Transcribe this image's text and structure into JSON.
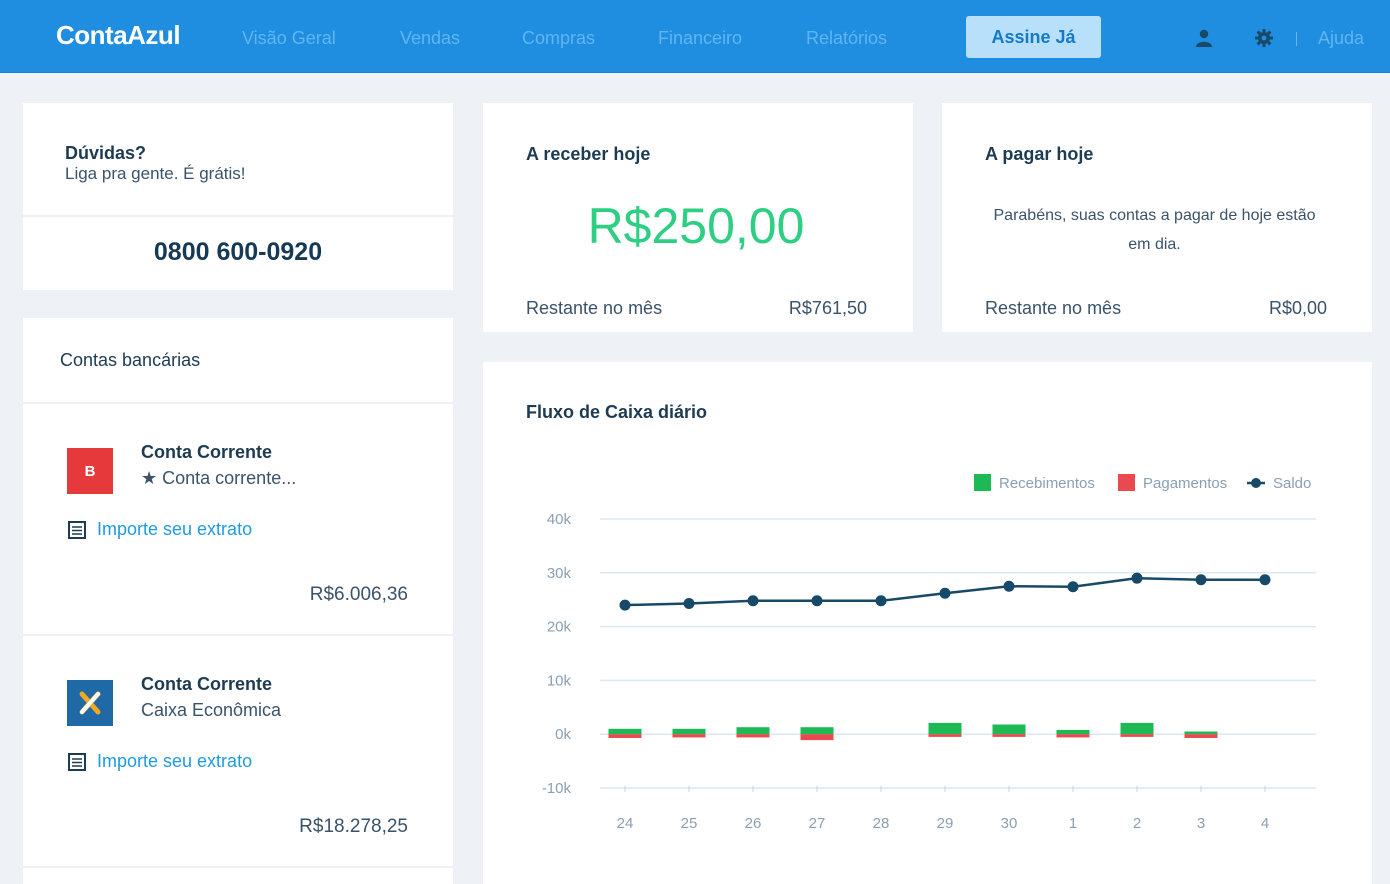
{
  "header": {
    "logo": "ContaAzul",
    "nav": [
      "Visão Geral",
      "Vendas",
      "Compras",
      "Financeiro",
      "Relatórios"
    ],
    "cta": "Assine Já",
    "help": "Ajuda"
  },
  "support": {
    "title": "Dúvidas?",
    "subtitle": "Liga pra gente. É grátis!",
    "phone": "0800 600-0920"
  },
  "receivable": {
    "title": "A receber hoje",
    "amount": "R$250,00",
    "remaining_label": "Restante no mês",
    "remaining_value": "R$761,50"
  },
  "payable": {
    "title": "A pagar hoje",
    "message": "Parabéns, suas contas a pagar de hoje estão em dia.",
    "remaining_label": "Restante no mês",
    "remaining_value": "R$0,00"
  },
  "bank": {
    "title": "Contas bancárias",
    "accounts": [
      {
        "name": "Conta Corrente",
        "desc": "★ Conta corrente...",
        "logo_letter": "B",
        "logo_color": "#e5393b",
        "import": "Importe seu extrato",
        "balance": "R$6.006,36"
      },
      {
        "name": "Conta Corrente",
        "desc": "Caixa Econômica",
        "logo_letter": "X",
        "logo_color": "#1f6aa6",
        "import": "Importe seu extrato",
        "balance": "R$18.278,25"
      }
    ]
  },
  "cashflow": {
    "title": "Fluxo de Caixa diário",
    "legend": [
      "Recebimentos",
      "Pagamentos",
      "Saldo"
    ]
  },
  "chart_data": {
    "type": "bar",
    "title": "Fluxo de Caixa diário",
    "categories": [
      "24",
      "25",
      "26",
      "27",
      "28",
      "29",
      "30",
      "1",
      "2",
      "3",
      "4"
    ],
    "y_ticks": [
      "40k",
      "30k",
      "20k",
      "10k",
      "0k",
      "-10k"
    ],
    "ylim": [
      -10000,
      40000
    ],
    "series": [
      {
        "name": "Recebimentos",
        "type": "bar",
        "color": "#1db954",
        "values": [
          1000,
          1000,
          1300,
          1300,
          0,
          2100,
          1800,
          800,
          2100,
          500,
          0
        ]
      },
      {
        "name": "Pagamentos",
        "type": "bar",
        "color": "#e84a4f",
        "values": [
          -700,
          -600,
          -600,
          -1100,
          0,
          -500,
          -500,
          -600,
          -500,
          -700,
          0
        ]
      },
      {
        "name": "Saldo",
        "type": "line",
        "color": "#174a68",
        "values": [
          24000,
          24300,
          24800,
          24800,
          24800,
          26200,
          27500,
          27400,
          29000,
          28700,
          28700
        ]
      }
    ],
    "legend_position": "top-right",
    "grid": true
  }
}
